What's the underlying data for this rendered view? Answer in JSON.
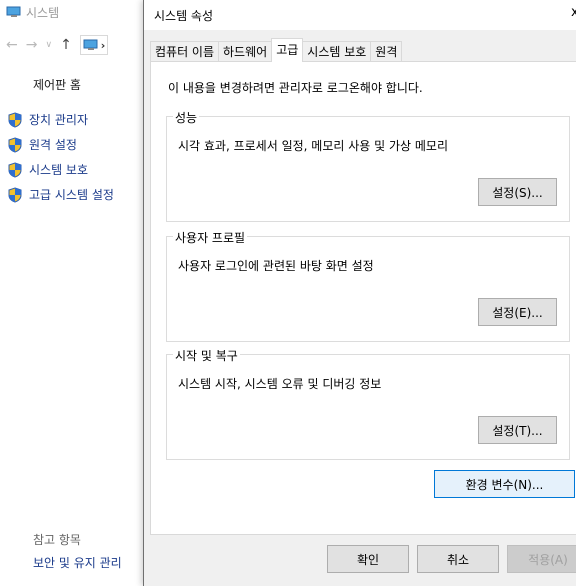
{
  "background": {
    "title": "시스템",
    "control_panel_home": "제어판 홈",
    "side_links": [
      {
        "label": "장치 관리자",
        "icon": "shield-icon"
      },
      {
        "label": "원격 설정",
        "icon": "shield-icon"
      },
      {
        "label": "시스템 보호",
        "icon": "shield-icon"
      },
      {
        "label": "고급 시스템 설정",
        "icon": "shield-icon"
      }
    ],
    "see_also": "참고 항목",
    "security_maintenance": "보안 및 유지 관리"
  },
  "dialog": {
    "title": "시스템 속성",
    "close": "x",
    "tabs": [
      {
        "label": "컴퓨터 이름",
        "active": false
      },
      {
        "label": "하드웨어",
        "active": false
      },
      {
        "label": "고급",
        "active": true
      },
      {
        "label": "시스템 보호",
        "active": false
      },
      {
        "label": "원격",
        "active": false
      }
    ],
    "admin_note": "이 내용을 변경하려면 관리자로 로그온해야 합니다.",
    "groups": [
      {
        "legend": "성능",
        "description": "시각 효과, 프로세서 일정, 메모리 사용 및 가상 메모리",
        "button": "설정(S)..."
      },
      {
        "legend": "사용자 프로필",
        "description": "사용자 로그인에 관련된 바탕 화면 설정",
        "button": "설정(E)..."
      },
      {
        "legend": "시작 및 복구",
        "description": "시스템 시작, 시스템 오류 및 디버깅 정보",
        "button": "설정(T)..."
      }
    ],
    "env_button": "환경 변수(N)...",
    "ok": "확인",
    "cancel": "취소",
    "apply": "적용(A)"
  },
  "colors": {
    "dialog_bg": "#f0f0f0",
    "link": "#1a3a8a",
    "focus_border": "#0078d7"
  }
}
